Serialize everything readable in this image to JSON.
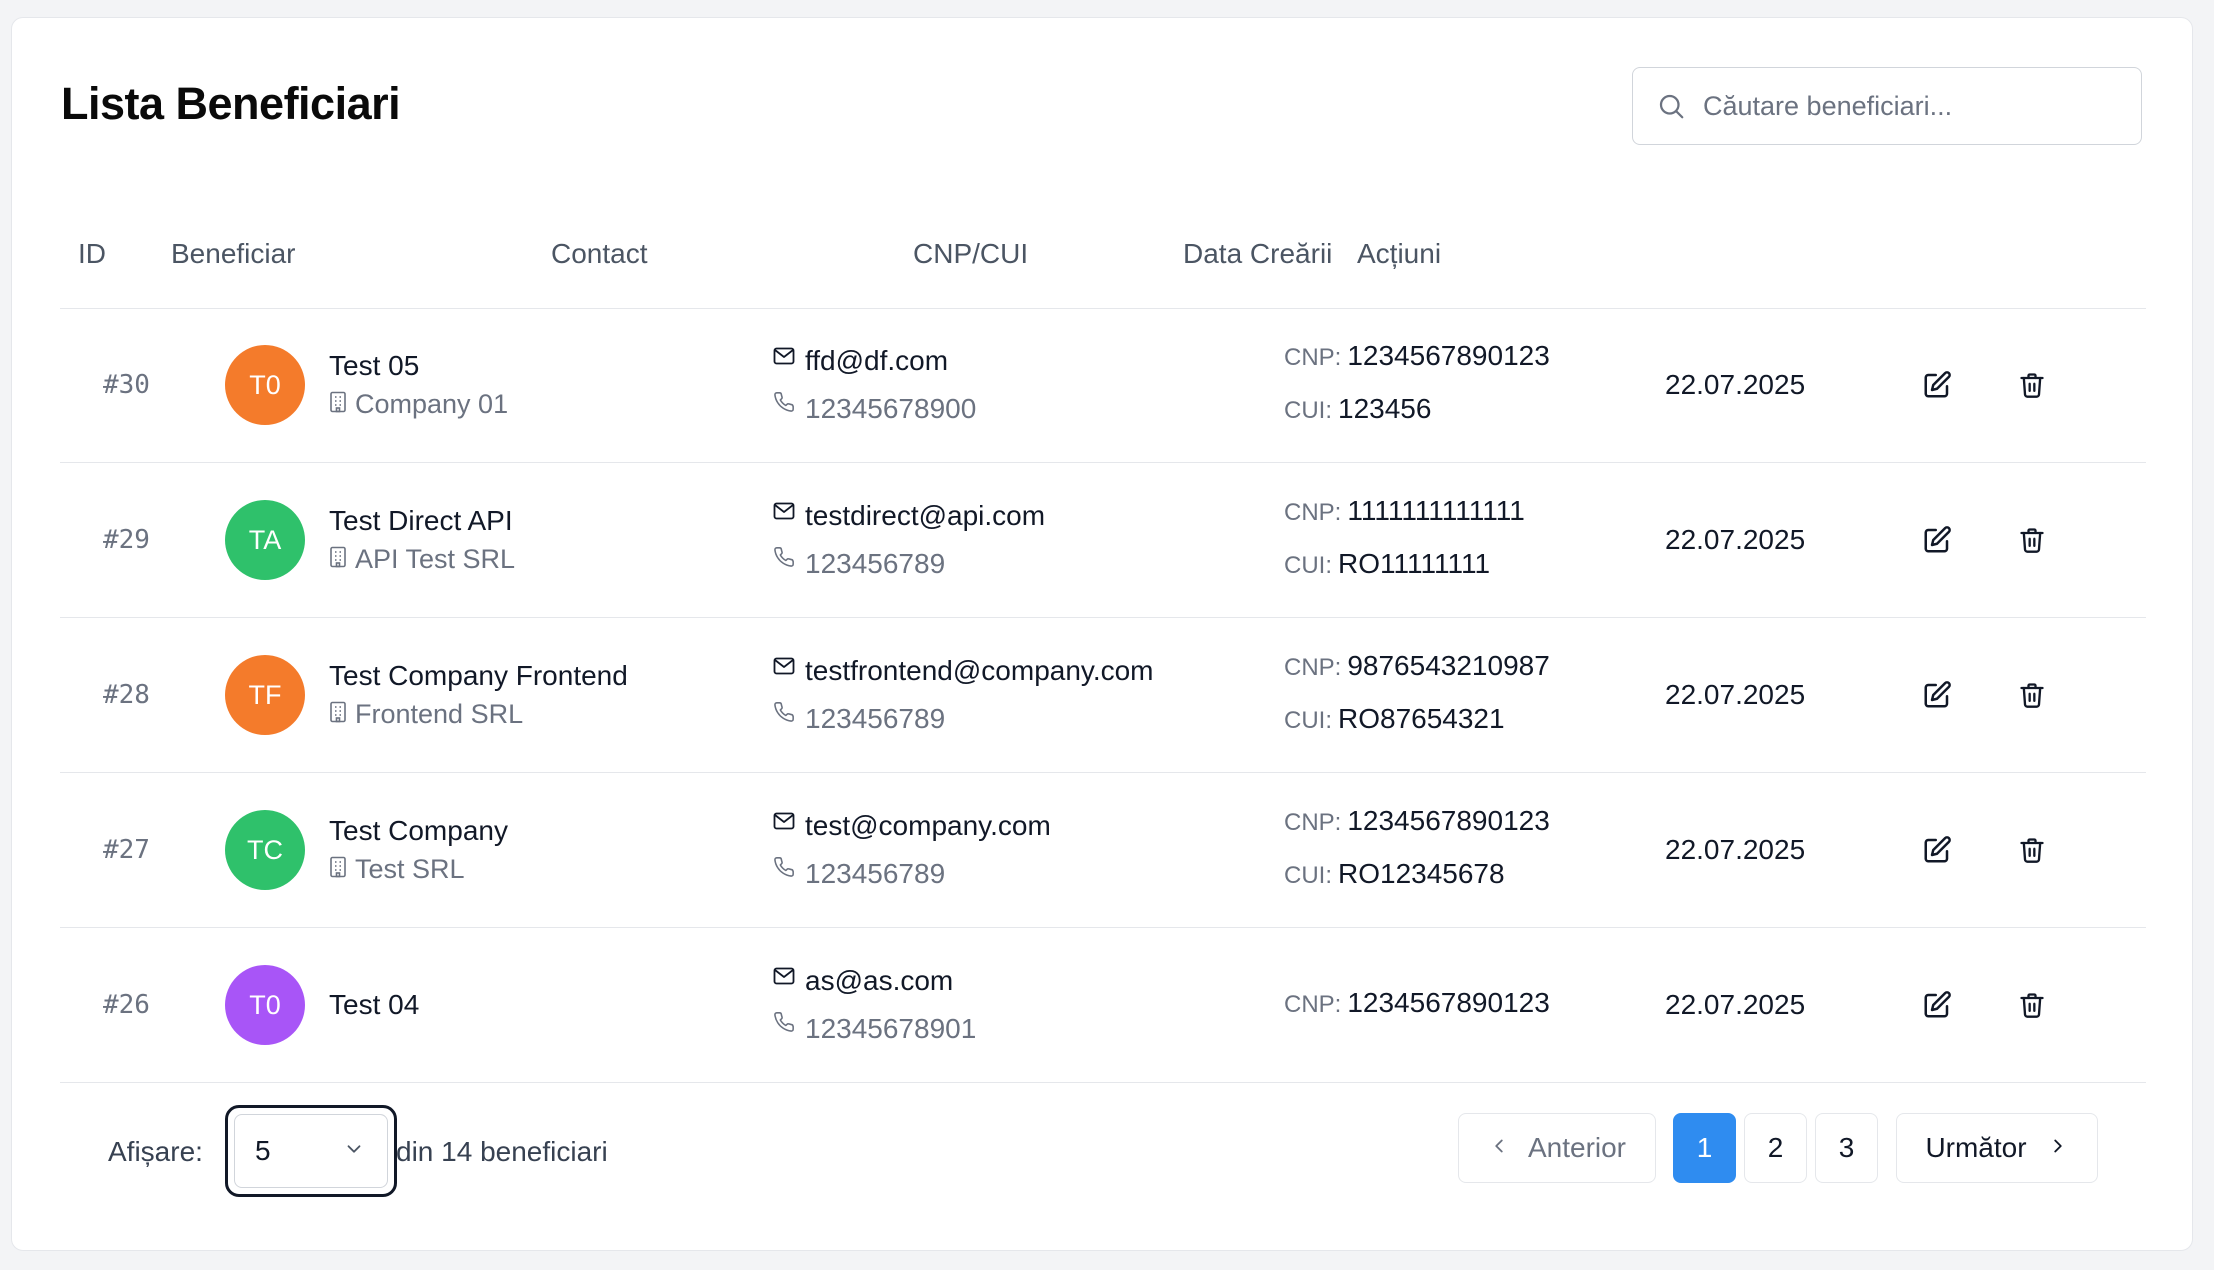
{
  "header": {
    "title": "Lista Beneficiari",
    "search_placeholder": "Căutare beneficiari..."
  },
  "table": {
    "columns": [
      "ID",
      "Beneficiar",
      "Contact",
      "CNP/CUI",
      "Data Creării",
      "Acțiuni"
    ],
    "cnp_label": "CNP:",
    "cui_label": "CUI:",
    "rows": [
      {
        "id": "#30",
        "initials": "T0",
        "avatar_color": "#f47b2b",
        "name": "Test 05",
        "company": "Company 01",
        "email": "ffd@df.com",
        "phone": "12345678900",
        "cnp": "1234567890123",
        "cui": "123456",
        "date": "22.07.2025"
      },
      {
        "id": "#29",
        "initials": "TA",
        "avatar_color": "#2fc16b",
        "name": "Test Direct API",
        "company": "API Test SRL",
        "email": "testdirect@api.com",
        "phone": "123456789",
        "cnp": "1111111111111",
        "cui": "RO11111111",
        "date": "22.07.2025"
      },
      {
        "id": "#28",
        "initials": "TF",
        "avatar_color": "#f47b2b",
        "name": "Test Company Frontend",
        "company": "Frontend SRL",
        "email": "testfrontend@company.com",
        "phone": "123456789",
        "cnp": "9876543210987",
        "cui": "RO87654321",
        "date": "22.07.2025"
      },
      {
        "id": "#27",
        "initials": "TC",
        "avatar_color": "#2fc16b",
        "name": "Test Company",
        "company": "Test SRL",
        "email": "test@company.com",
        "phone": "123456789",
        "cnp": "1234567890123",
        "cui": "RO12345678",
        "date": "22.07.2025"
      },
      {
        "id": "#26",
        "initials": "T0",
        "avatar_color": "#a855f7",
        "name": "Test 04",
        "company": "",
        "email": "as@as.com",
        "phone": "12345678901",
        "cnp": "1234567890123",
        "cui": "",
        "date": "22.07.2025"
      }
    ]
  },
  "pagination": {
    "show_label": "Afișare:",
    "page_size": "5",
    "total_text": "din 14 beneficiari",
    "prev_label": "Anterior",
    "next_label": "Următor",
    "pages": [
      "1",
      "2",
      "3"
    ],
    "active_page": "1",
    "active_color": "#2f8cf0"
  }
}
